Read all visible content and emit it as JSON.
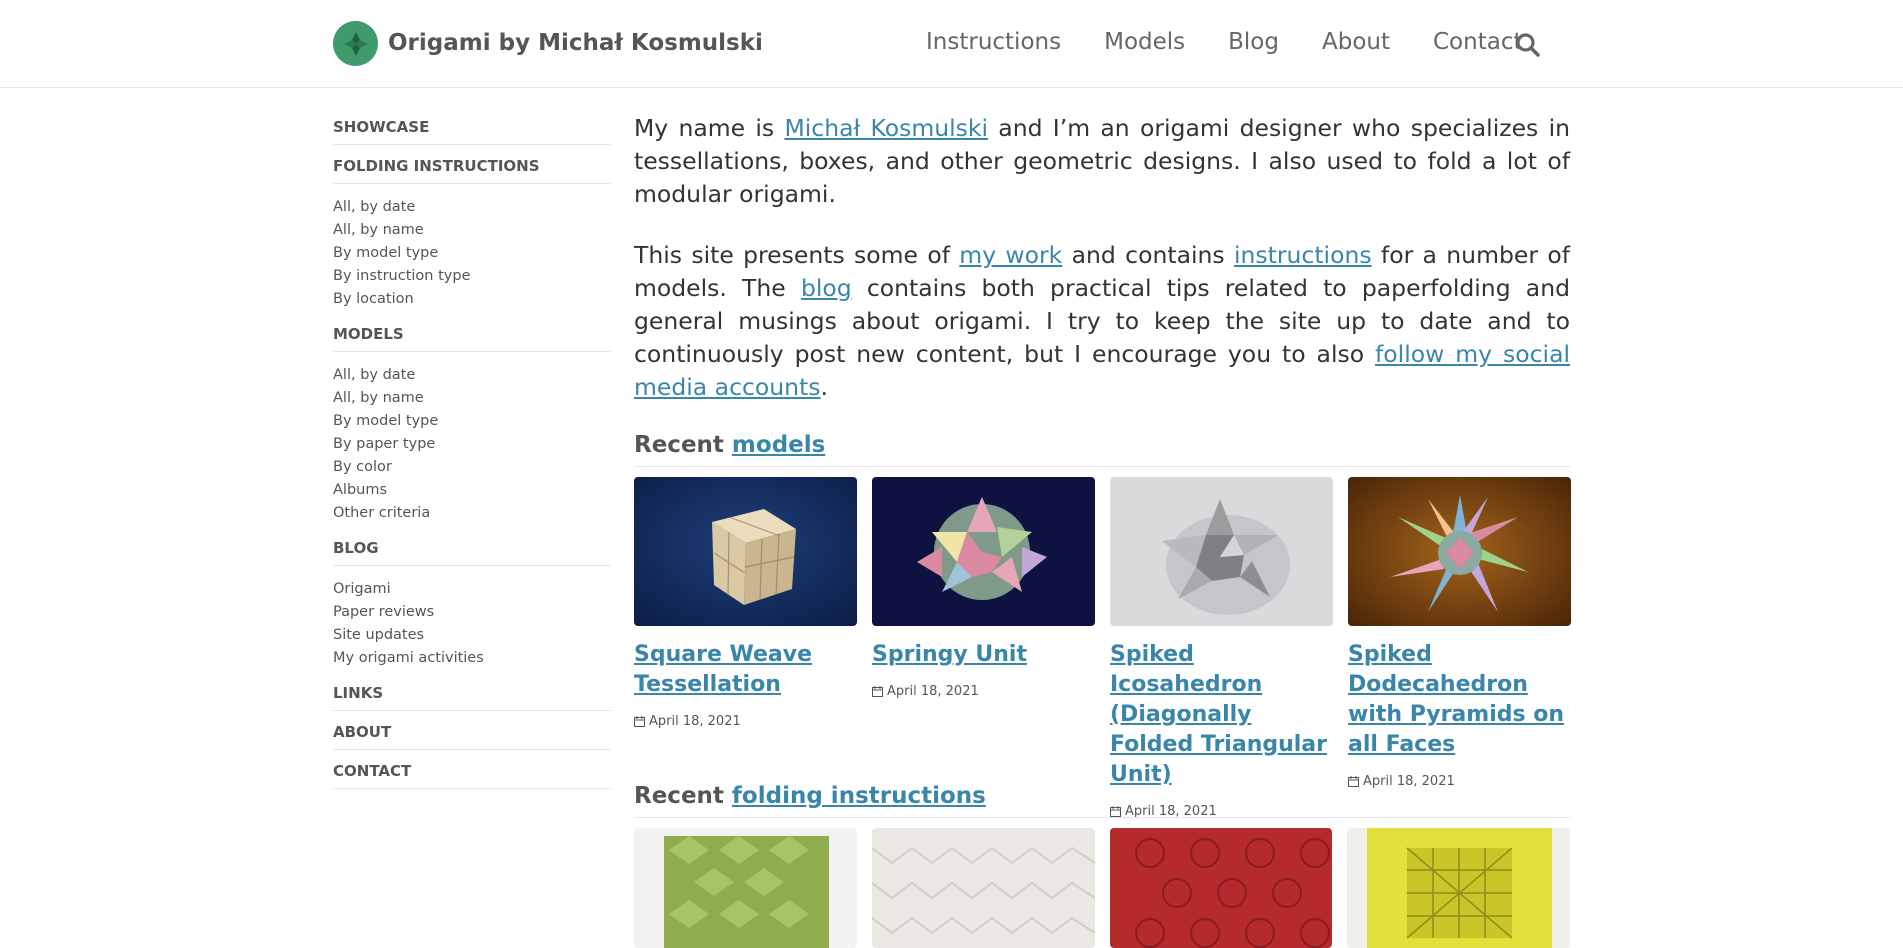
{
  "site": {
    "title": "Origami by Michał Kosmulski",
    "accent": "#3a86a8",
    "logo_color": "#3f9a6c"
  },
  "nav": {
    "items": [
      "Instructions",
      "Models",
      "Blog",
      "About",
      "Contact"
    ],
    "search_icon": "search-icon"
  },
  "sidebar": {
    "showcase": "SHOWCASE",
    "folding_instructions": {
      "heading": "FOLDING INSTRUCTIONS",
      "links": [
        "All, by date",
        "All, by name",
        "By model type",
        "By instruction type",
        "By location"
      ]
    },
    "models": {
      "heading": "MODELS",
      "links": [
        "All, by date",
        "All, by name",
        "By model type",
        "By paper type",
        "By color",
        "Albums",
        "Other criteria"
      ]
    },
    "blog": {
      "heading": "BLOG",
      "links": [
        "Origami",
        "Paper reviews",
        "Site updates",
        "My origami activities"
      ]
    },
    "links": "LINKS",
    "about": "ABOUT",
    "contact": "CONTACT"
  },
  "intro": {
    "p1_a": "My name is ",
    "p1_link": "Michał Kosmulski",
    "p1_b": " and I’m an origami designer who specializes in tessellations, boxes, and other geometric designs. I also used to fold a lot of modular origami.",
    "p2_a": "This site presents some of ",
    "p2_link1": "my work",
    "p2_b": " and contains ",
    "p2_link2": "instructions",
    "p2_c": " for a number of models. The ",
    "p2_link3": "blog",
    "p2_d": " contains both practical tips related to paperfolding and general musings about origami. I try to keep the site up to date and to continuously post new content, but I encourage you to also ",
    "p2_link4": "follow my social media accounts",
    "p2_e": "."
  },
  "recent_models": {
    "prefix": "Recent ",
    "link": "models",
    "cards": [
      {
        "title": "Square Weave Tessellation",
        "date": "April 18, 2021"
      },
      {
        "title": "Springy Unit",
        "date": "April 18, 2021"
      },
      {
        "title": "Spiked Icosahedron (Diagonally Folded Triangular Unit)",
        "date": "April 18, 2021"
      },
      {
        "title": "Spiked Dodecahedron with Pyramids on all Faces",
        "date": "April 18, 2021"
      }
    ]
  },
  "recent_instructions": {
    "prefix": "Recent ",
    "link": "folding instructions"
  }
}
